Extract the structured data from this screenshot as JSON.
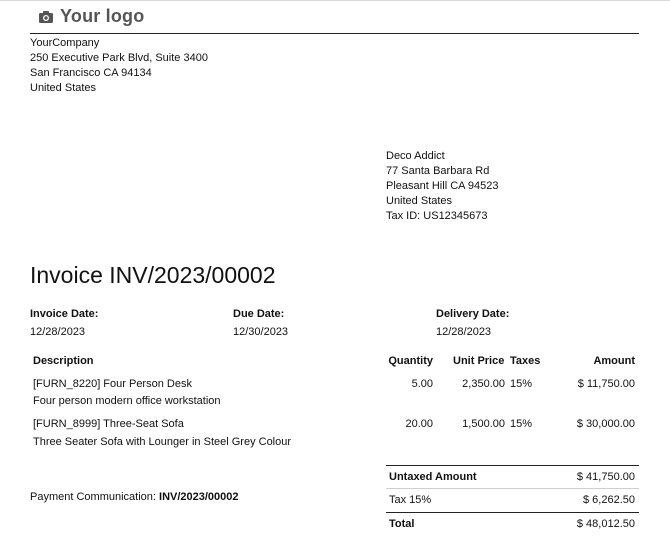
{
  "logo": {
    "text": "Your logo",
    "icon": "camera-icon"
  },
  "company": {
    "name": "YourCompany",
    "street": "250 Executive Park Blvd, Suite 3400",
    "city": "San Francisco CA 94134",
    "country": "United States"
  },
  "partner": {
    "name": "Deco Addict",
    "street": "77 Santa Barbara Rd",
    "city": "Pleasant Hill CA 94523",
    "country": "United States",
    "tax_id": "Tax ID: US12345673"
  },
  "invoice": {
    "title": "Invoice INV/2023/00002",
    "invoice_date_label": "Invoice Date:",
    "invoice_date": "12/28/2023",
    "due_date_label": "Due Date:",
    "due_date": "12/30/2023",
    "delivery_date_label": "Delivery Date:",
    "delivery_date": "12/28/2023"
  },
  "table": {
    "headers": {
      "description": "Description",
      "quantity": "Quantity",
      "unit_price": "Unit Price",
      "taxes": "Taxes",
      "amount": "Amount"
    },
    "lines": [
      {
        "name": "[FURN_8220] Four Person Desk",
        "desc": "Four person modern office workstation",
        "qty": "5.00",
        "price": "2,350.00",
        "tax": "15%",
        "amount": "$ 11,750.00"
      },
      {
        "name": "[FURN_8999] Three-Seat Sofa",
        "desc": "Three Seater Sofa with Lounger in Steel Grey Colour",
        "qty": "20.00",
        "price": "1,500.00",
        "tax": "15%",
        "amount": "$ 30,000.00"
      }
    ]
  },
  "totals": {
    "untaxed_label": "Untaxed Amount",
    "untaxed": "$ 41,750.00",
    "tax_label": "Tax 15%",
    "tax": "$ 6,262.50",
    "total_label": "Total",
    "total": "$ 48,012.50"
  },
  "payment": {
    "label": "Payment Communication:",
    "value": "INV/2023/00002"
  },
  "colors": {
    "text": "#111111",
    "logo": "#555555",
    "rule": "#222222"
  }
}
